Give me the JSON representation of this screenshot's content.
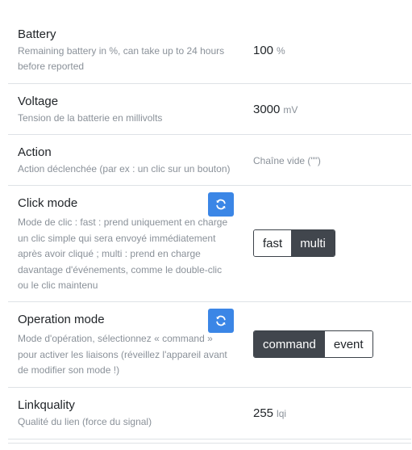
{
  "rows": {
    "battery": {
      "title": "Battery",
      "desc_line1": "Remaining battery in %, can take up to 24 hours",
      "desc_line2": "before reported",
      "value": "100",
      "unit": "%"
    },
    "voltage": {
      "title": "Voltage",
      "desc": "Tension de la batterie en millivolts",
      "value": "3000",
      "unit": "mV"
    },
    "action": {
      "title": "Action",
      "desc": "Action déclenchée (par ex : un clic sur un bouton)",
      "value": "Chaîne vide (\"\")"
    },
    "click_mode": {
      "title": "Click mode",
      "desc_lines": [
        "Mode de clic : fast : prend uniquement en charge",
        "un clic simple qui sera envoyé immédiatement",
        "après avoir cliqué ; multi : prend en charge",
        "davantage d'événements, comme le double-clic",
        "ou le clic maintenu"
      ],
      "options": [
        "fast",
        "multi"
      ],
      "selected": "multi",
      "refresh_icon": "refresh-icon"
    },
    "operation_mode": {
      "title": "Operation mode",
      "desc_lines": [
        "Mode d'opération, sélectionnez « command »",
        "pour activer les liaisons (réveillez l'appareil avant",
        "de modifier son mode !)"
      ],
      "options": [
        "command",
        "event"
      ],
      "selected": "command",
      "refresh_icon": "refresh-icon"
    },
    "linkquality": {
      "title": "Linkquality",
      "desc": "Qualité du lien (force du signal)",
      "value": "255",
      "unit": "lqi"
    }
  },
  "colors": {
    "accent": "#3b86e6",
    "active_segment": "#41464d",
    "muted_text": "#8a9199",
    "divider": "#dee2e6"
  }
}
